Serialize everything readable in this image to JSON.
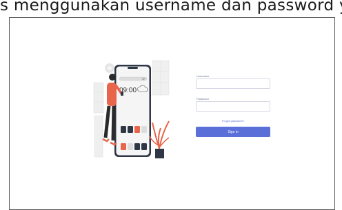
{
  "caption": "s menggunakan username dan password yang telah",
  "login": {
    "username_label": "Username",
    "password_label": "Password",
    "username_value": "",
    "password_value": "",
    "forgot_label": "Forgot password?",
    "signin_label": "Sign in"
  },
  "illustration": {
    "time": "09:00",
    "accent": "#e8644a",
    "primary": "#5a6fd8"
  }
}
